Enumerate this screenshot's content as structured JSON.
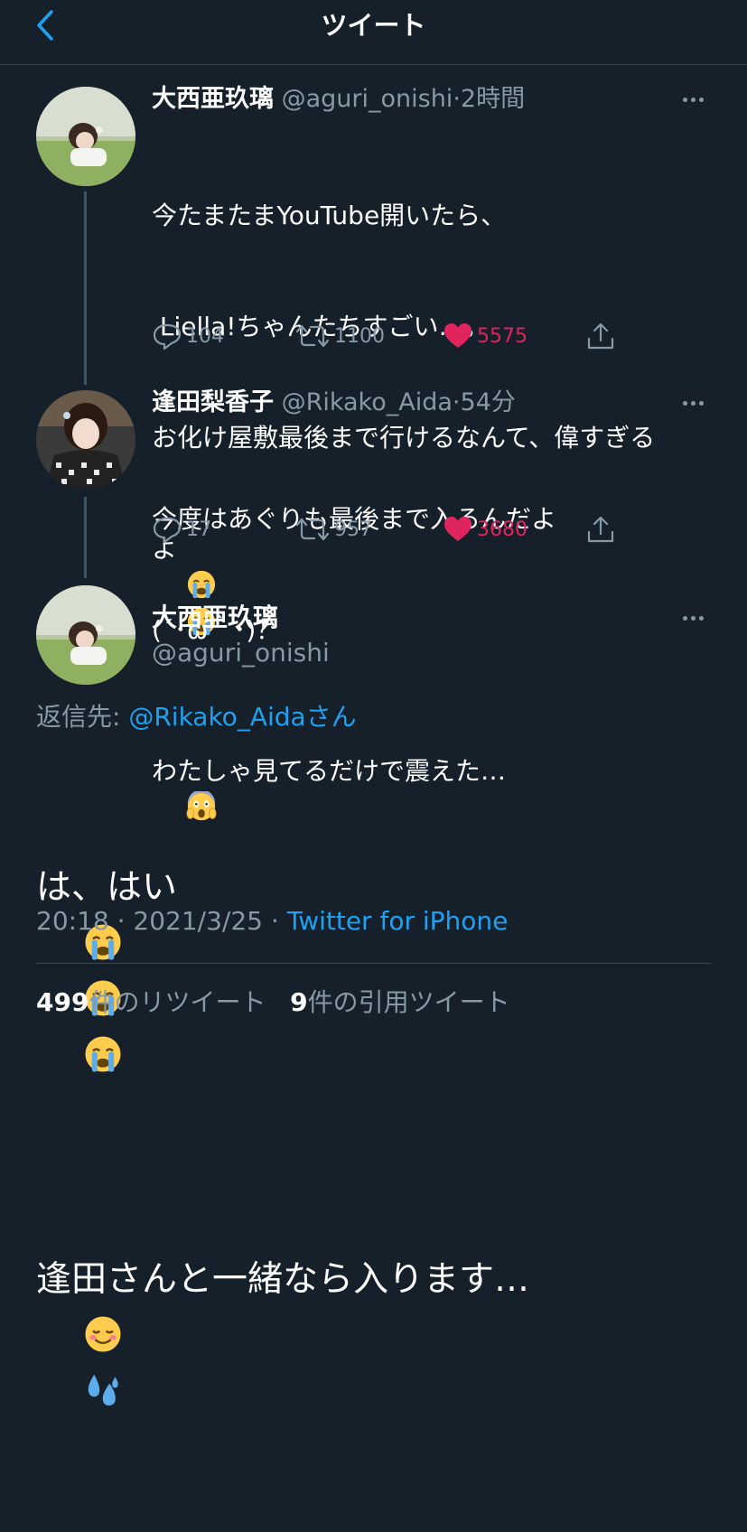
{
  "header": {
    "title": "ツイート"
  },
  "tweets": [
    {
      "name": "大西亜玖璃",
      "handle": "@aguri_onishi",
      "time": "2時間",
      "lines": [
        "今たまたまYouTube開いたら、",
        " Liella!ちゃんたちすごい…。",
        "お化け屋敷最後まで行けるなんて、偉すぎる",
        "よ",
        "わたしゃ見てるだけで震えた…"
      ],
      "replies": "104",
      "retweets": "1100",
      "likes": "5575"
    },
    {
      "name": "逢田梨香子",
      "handle": "@Rikako_Aida",
      "time": "54分",
      "lines": [
        "今度はあぐりも最後まで入るんだよ",
        "(´･ω｀･)？"
      ],
      "replies": "17",
      "retweets": "957",
      "likes": "3680"
    }
  ],
  "main_tweet": {
    "name": "大西亜玖璃",
    "handle": "@aguri_onishi",
    "reply_prefix": "返信先: ",
    "reply_to": "@Rikako_Aida",
    "reply_suffix": "さん",
    "line1": "は、はい",
    "line2": "逢田さんと一緒なら入ります…",
    "time": "20:18",
    "date": "2021/3/25",
    "source": "Twitter for iPhone",
    "retweet_count": "499",
    "retweet_label": "件のリツイート",
    "quote_count": "9",
    "quote_label": "件の引用ツイート"
  },
  "colors": {
    "background": "#15202b",
    "accent": "#1da1f2",
    "like": "#e0245e",
    "secondary_text": "#8899a6"
  },
  "icons": [
    "back-chevron-icon",
    "more-icon",
    "reply-icon",
    "retweet-icon",
    "heart-icon",
    "share-icon",
    "loudly-crying-face-icon",
    "screaming-face-icon",
    "smiling-face-icon",
    "sweat-droplets-icon"
  ]
}
